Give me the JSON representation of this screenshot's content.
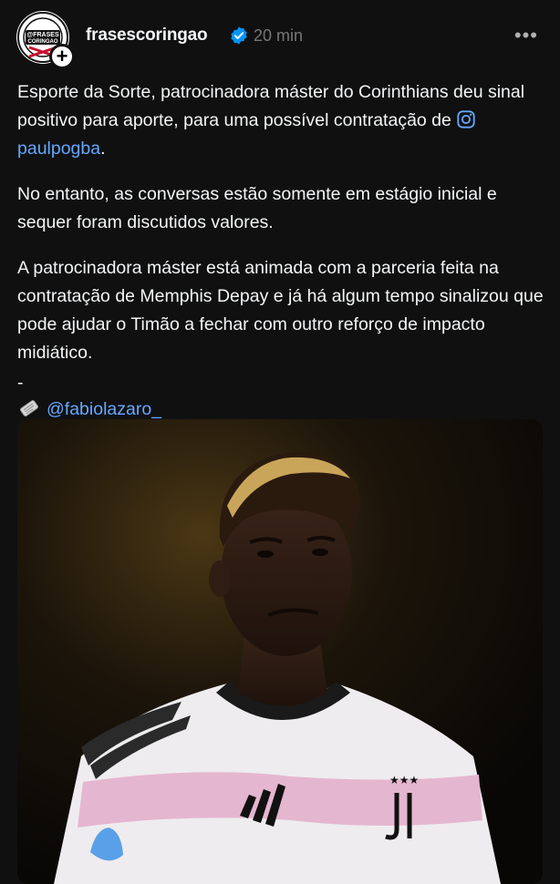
{
  "post": {
    "author": "frasescoringao",
    "time": "20 min",
    "more_label": "•••",
    "follow_symbol": "+",
    "avatar_text_line1": "@FRASES",
    "avatar_text_line2": "CORINGAO",
    "paragraph1_text": "Esporte da Sorte, patrocinadora máster do Corinthians deu sinal positivo para aporte, para uma possível contratação de ",
    "paragraph1_mention": "paulpogba",
    "paragraph1_end": ".",
    "paragraph2": "No entanto, as conversas estão somente em estágio inicial e sequer foram discutidos valores.",
    "paragraph3": "A patrocinadora máster está animada com a parceria feita na contratação de Memphis Depay e já há algum tempo sinalizou que pode ajudar o Timão a fechar com outro reforço de impacto midiático.",
    "separator": "-",
    "credit_mention": "@fabiolazaro_"
  },
  "icons": {
    "verified": "verified-badge-icon",
    "instagram": "instagram-icon",
    "newspaper": "newspaper-icon"
  },
  "colors": {
    "background": "#101010",
    "mention": "#66a7ff",
    "verified": "#0095f6",
    "muted": "#777777"
  }
}
